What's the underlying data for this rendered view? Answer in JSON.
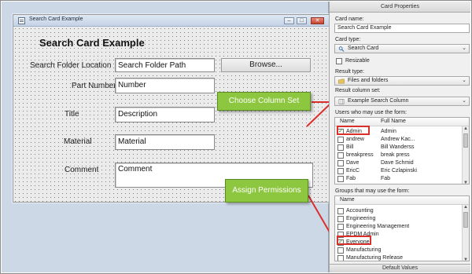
{
  "window": {
    "title": "Search Card Example",
    "buttons": {
      "minimize": "–",
      "maximize": "□",
      "close": "✕"
    }
  },
  "form": {
    "title": "Search Card Example",
    "fields": [
      {
        "label": "Search Folder Location",
        "value": "Search Folder Path"
      },
      {
        "label": "Part Number",
        "value": "Number"
      },
      {
        "label": "Title",
        "value": "Description"
      },
      {
        "label": "Material",
        "value": "Material"
      },
      {
        "label": "Comment",
        "value": "Comment"
      }
    ],
    "browse_label": "Browse..."
  },
  "callouts": {
    "choose_column_set": "Choose Column Set",
    "assign_permissions": "Assign Permissions"
  },
  "panel": {
    "header": "Card Properties",
    "card_name_label": "Card name:",
    "card_name_value": "Search Card Example",
    "card_type_label": "Card type:",
    "card_type_value": "Search Card",
    "resizable_label": "Resizable",
    "resizable_checked": false,
    "result_type_label": "Result type:",
    "result_type_value": "Files and folders",
    "result_column_set_label": "Result column set:",
    "result_column_set_value": "Example Search Column",
    "users_label": "Users who may use the form:",
    "users_columns": [
      "Name",
      "Full Name"
    ],
    "users": [
      {
        "name": "Admin",
        "full_name": "Admin",
        "checked": true
      },
      {
        "name": "andrew",
        "full_name": "Andrew Kac...",
        "checked": false
      },
      {
        "name": "Bill",
        "full_name": "Bill Wanderss",
        "checked": false
      },
      {
        "name": "breakpress",
        "full_name": "break press",
        "checked": false
      },
      {
        "name": "Dave",
        "full_name": "Dave Schmid",
        "checked": false
      },
      {
        "name": "EricC",
        "full_name": "Eric Czlapinski",
        "checked": false
      },
      {
        "name": "Fab",
        "full_name": "Fab",
        "checked": false
      }
    ],
    "groups_label": "Groups that may use the form:",
    "groups_column": "Name",
    "groups": [
      {
        "name": "Accounting",
        "checked": false
      },
      {
        "name": "Engineering",
        "checked": false
      },
      {
        "name": "Engineering Management",
        "checked": false
      },
      {
        "name": "EPDM Admin",
        "checked": false
      },
      {
        "name": "Everyone",
        "checked": true
      },
      {
        "name": "Manufacturing",
        "checked": false
      },
      {
        "name": "Manufacturing Release",
        "checked": false
      }
    ],
    "footer": "Default Values"
  },
  "colors": {
    "callout_green": "#8dc63f",
    "highlight_red": "#d9302b",
    "workspace_bg": "#cdd8e6"
  }
}
